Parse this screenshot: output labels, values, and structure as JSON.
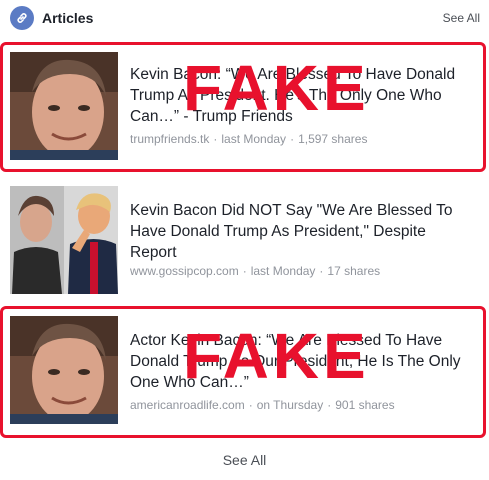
{
  "header": {
    "title": "Articles",
    "see_all": "See All",
    "icon": "link-icon"
  },
  "articles": [
    {
      "headline": "Kevin Bacon: “We Are Blessed To Have Donald Trump As President. He’s The Only One Who Can…” - Trump Friends",
      "source": "trumpfriends.tk",
      "time": "last Monday",
      "shares": "1,597 shares",
      "overlay": "FAKE"
    },
    {
      "headline": "Kevin Bacon Did NOT Say \"We Are Blessed To Have Donald Trump As President,\" Despite Report",
      "source": "www.gossipcop.com",
      "time": "last Monday",
      "shares": "17 shares"
    },
    {
      "headline": "Actor Kevin Bacon: “We Are Blessed To Have Donald Trump As Our President, He Is The Only One Who Can…”",
      "source": "americanroadlife.com",
      "time": "on Thursday",
      "shares": "901 shares",
      "overlay": "FAKE"
    }
  ],
  "footer": {
    "see_all": "See All"
  },
  "colors": {
    "fake_red": "#e8112d",
    "badge_blue": "#5b7bc4",
    "meta_gray": "#90949c"
  }
}
